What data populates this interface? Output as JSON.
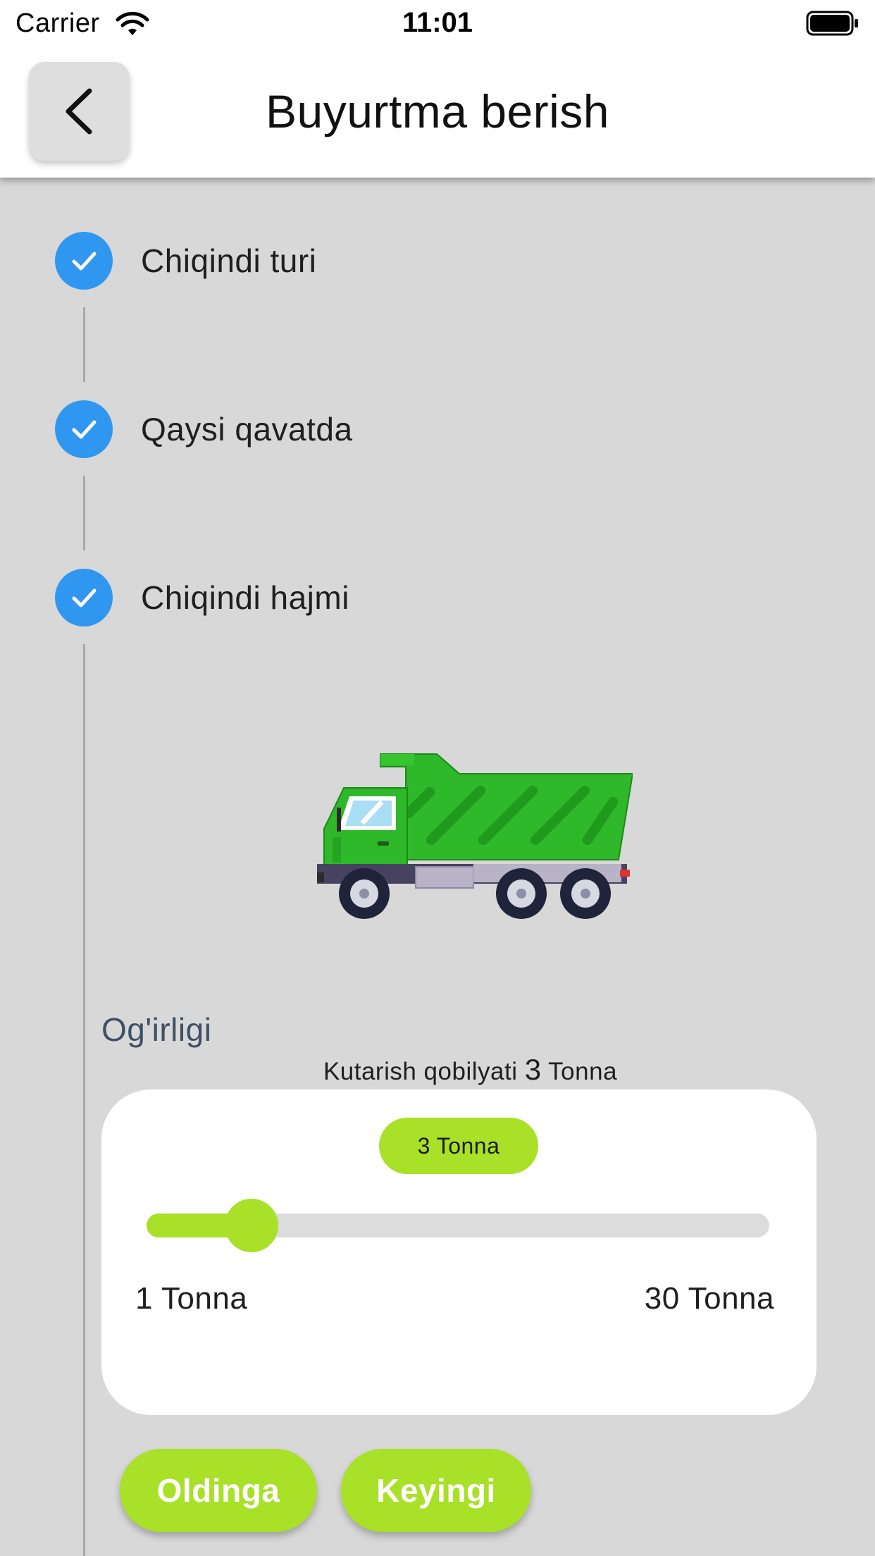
{
  "status_bar": {
    "carrier": "Carrier",
    "time": "11:01",
    "icons": [
      "wifi-icon",
      "battery-icon"
    ]
  },
  "header": {
    "title": "Buyurtma berish",
    "back_icon": "chevron-left-icon"
  },
  "steps": [
    {
      "label": "Chiqindi turi",
      "completed": true,
      "icon": "check-icon"
    },
    {
      "label": "Qaysi qavatda",
      "completed": true,
      "icon": "check-icon"
    },
    {
      "label": "Chiqindi hajmi",
      "completed": true,
      "icon": "check-icon"
    }
  ],
  "truck_image": "dump-truck-illustration",
  "weight": {
    "label": "Og'irligi",
    "capacity_prefix": "Kutarish qobilyati",
    "capacity_value": "3",
    "capacity_unit": "Tonna",
    "bubble_text": "3 Tonna",
    "min_label": "1 Tonna",
    "max_label": "30 Tonna",
    "value": 3,
    "min": 1,
    "max": 30
  },
  "buttons": {
    "previous": "Oldinga",
    "next": "Keyingi"
  },
  "colors": {
    "accent": "#a9e028",
    "step_blue": "#2f97ef",
    "background": "#d8d8d8",
    "card": "#ffffff",
    "truck_green": "#2eb82a"
  }
}
